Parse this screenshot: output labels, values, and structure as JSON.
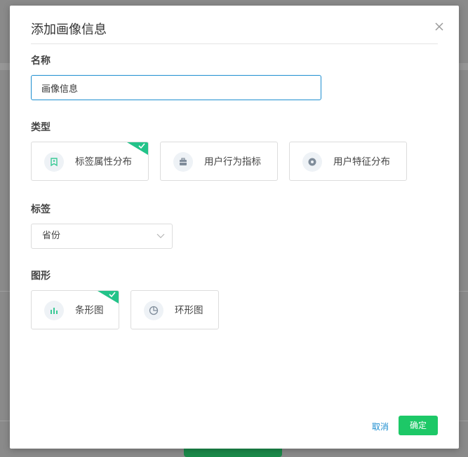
{
  "dialog": {
    "title": "添加画像信息",
    "close_icon": "close-icon"
  },
  "name_section": {
    "label": "名称",
    "value": "画像信息",
    "placeholder": ""
  },
  "type_section": {
    "label": "类型",
    "options": [
      {
        "label": "标签属性分布",
        "icon": "tag-icon",
        "selected": true
      },
      {
        "label": "用户行为指标",
        "icon": "briefcase-icon",
        "selected": false
      },
      {
        "label": "用户特征分布",
        "icon": "target-icon",
        "selected": false
      }
    ]
  },
  "tag_section": {
    "label": "标签",
    "selected": "省份",
    "chevron_icon": "chevron-down-icon"
  },
  "chart_section": {
    "label": "图形",
    "options": [
      {
        "label": "条形图",
        "icon": "bar-chart-icon",
        "selected": true
      },
      {
        "label": "环形图",
        "icon": "pie-chart-icon",
        "selected": false
      }
    ]
  },
  "footer": {
    "cancel_label": "取消",
    "confirm_label": "确定"
  },
  "colors": {
    "accent_green": "#23c389",
    "confirm_green": "#1dc867",
    "link_blue": "#1d8ed0",
    "overlay": "#8a8a8a"
  }
}
